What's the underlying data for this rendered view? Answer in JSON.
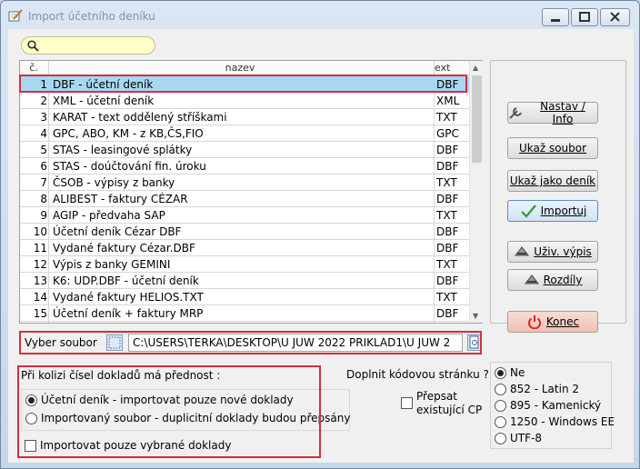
{
  "window": {
    "title": "Import účetního deníku"
  },
  "search": {
    "value": "",
    "placeholder": ""
  },
  "list": {
    "headers": {
      "no": "č.",
      "name": "nazev",
      "ext": "ext"
    },
    "rows": [
      {
        "no": "1",
        "name": "DBF  - účetní deník",
        "ext": "DBF",
        "selected": true
      },
      {
        "no": "2",
        "name": "XML  - účetní deník",
        "ext": "XML"
      },
      {
        "no": "3",
        "name": "KARAT - text oddělený stříškami",
        "ext": "TXT"
      },
      {
        "no": "4",
        "name": "GPC, ABO, KM  - z KB,ČS,FIO",
        "ext": "GPC"
      },
      {
        "no": "5",
        "name": "STAS - leasingové splátky",
        "ext": "DBF"
      },
      {
        "no": "6",
        "name": "STAS - doúčtování fin. úroku",
        "ext": "DBF"
      },
      {
        "no": "7",
        "name": "ČSOB - výpisy z banky",
        "ext": "TXT"
      },
      {
        "no": "8",
        "name": "ALIBEST - faktury CÉZAR",
        "ext": "DBF"
      },
      {
        "no": "9",
        "name": "AGIP - předvaha SAP",
        "ext": "TXT"
      },
      {
        "no": "10",
        "name": "Účetní deník   Cézar DBF",
        "ext": "DBF"
      },
      {
        "no": "11",
        "name": "Vydané faktury Cézar.DBF",
        "ext": "DBF"
      },
      {
        "no": "12",
        "name": "Výpis z banky GEMINI",
        "ext": "TXT"
      },
      {
        "no": "13",
        "name": "K6: UDP.DBF  - účetní deník",
        "ext": "DBF"
      },
      {
        "no": "14",
        "name": "Vydané faktury HELIOS.TXT",
        "ext": "TXT"
      },
      {
        "no": "15",
        "name": "Účetní deník + faktury MRP",
        "ext": "DBF"
      }
    ]
  },
  "buttons": {
    "setup": "Nastav / Info",
    "show_file": "Ukaž soubor",
    "show_as_journal": "Ukaž jako deník",
    "import": "Importuj",
    "user_statements": "Uživ. výpis",
    "differences": "Rozdíly",
    "close": "Konec"
  },
  "file": {
    "label": "Vyber soubor",
    "path": "C:\\USERS\\TERKA\\DESKTOP\\U  JUW  2022  PRIKLAD1\\U  JUW  2"
  },
  "collision": {
    "title": "Při kolizi čísel dokladů má přednost :",
    "options": [
      {
        "label": "Účetní deník - importovat pouze nové doklady",
        "selected": true
      },
      {
        "label": "Importovaný soubor - duplicitní doklady budou přepsány",
        "selected": false
      }
    ],
    "selected_only_label": "Importovat pouze vybrané doklady"
  },
  "codepage": {
    "question": "Doplnit kódovou stránku ?",
    "overwrite_line1": "Přepsat",
    "overwrite_line2": "existující CP",
    "options": [
      {
        "label": "Ne",
        "selected": true
      },
      {
        "label": "852 - Latin 2",
        "selected": false
      },
      {
        "label": "895 - Kamenický",
        "selected": false
      },
      {
        "label": "1250 - Windows EE",
        "selected": false
      },
      {
        "label": "UTF-8",
        "selected": false
      }
    ]
  },
  "colors": {
    "highlight_red": "#d32f3f",
    "selection_blue": "#a8d8f0",
    "search_yellow": "#ffffc8",
    "import_check_green": "#2e9d2e",
    "close_icon_red": "#e02020"
  }
}
